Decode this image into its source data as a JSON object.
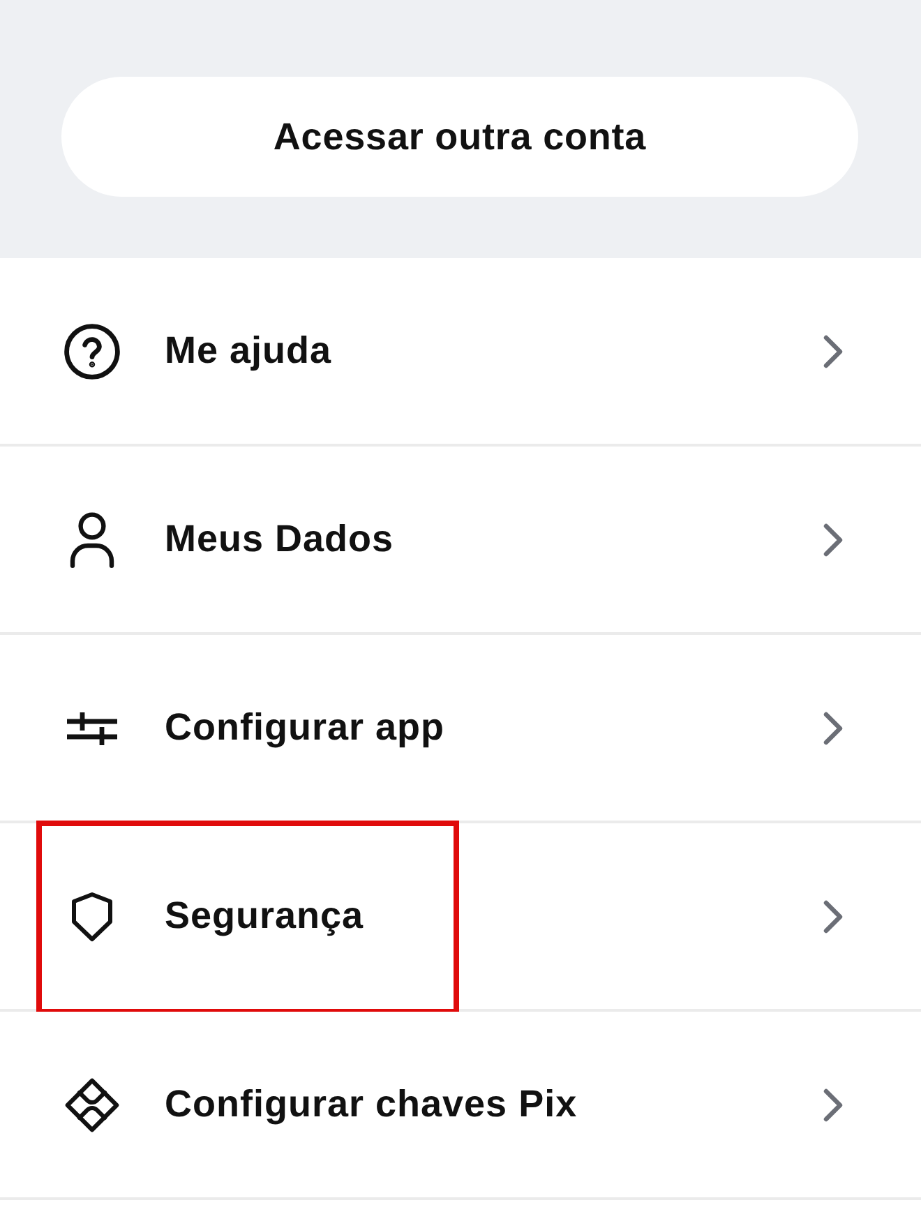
{
  "account_button": {
    "label": "Acessar outra conta"
  },
  "menu_items": [
    {
      "kind": "help",
      "label": "Me ajuda",
      "highlighted": false
    },
    {
      "kind": "profile",
      "label": "Meus Dados",
      "highlighted": false
    },
    {
      "kind": "settings",
      "label": "Configurar app",
      "highlighted": false
    },
    {
      "kind": "security",
      "label": "Segurança",
      "highlighted": true
    },
    {
      "kind": "pix",
      "label": "Configurar chaves Pix",
      "highlighted": false
    }
  ]
}
